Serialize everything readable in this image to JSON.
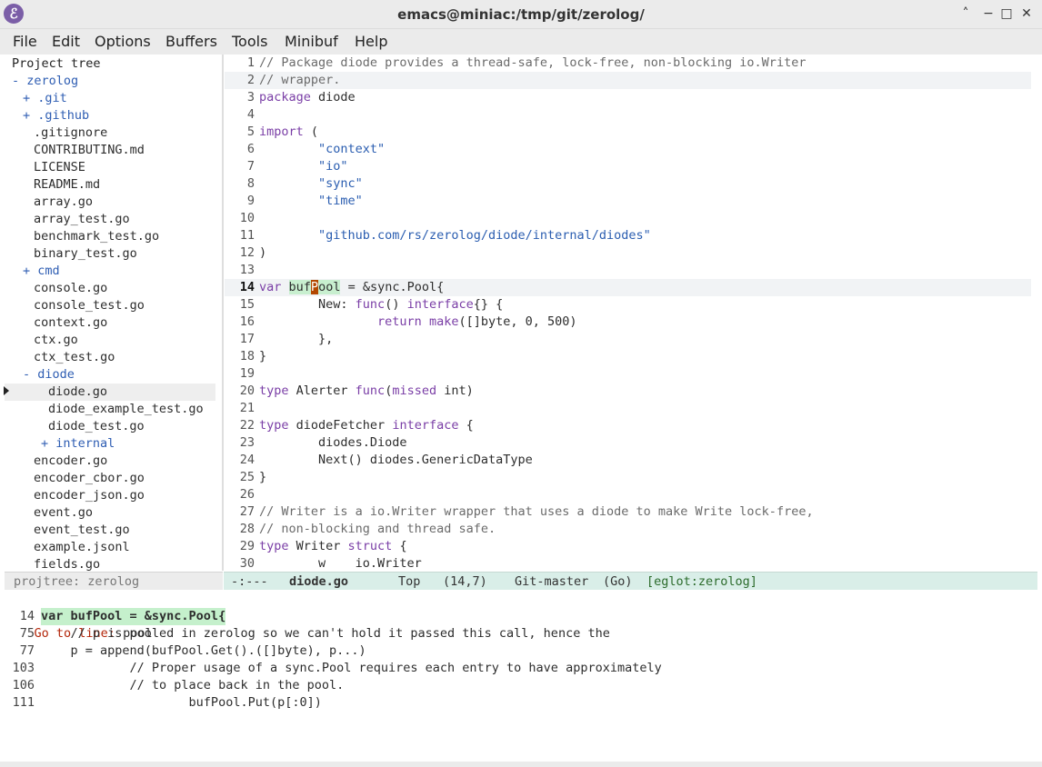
{
  "window": {
    "title": "emacs@miniac:/tmp/git/zerolog/",
    "app_icon": "emacs-icon",
    "app_icon_glyph": "ℰ",
    "controls": [
      "˄",
      "−",
      "□",
      "✕"
    ]
  },
  "menubar": {
    "items": [
      "File",
      "Edit",
      "Options",
      "Buffers",
      "Tools",
      "Minibuf",
      "Help"
    ]
  },
  "tree": {
    "header": "Project tree",
    "rows": [
      {
        "text": "- zerolog",
        "kind": "dir",
        "indent": 0
      },
      {
        "text": "+ .git",
        "kind": "dir",
        "indent": 1
      },
      {
        "text": "+ .github",
        "kind": "dir",
        "indent": 1
      },
      {
        "text": ".gitignore",
        "kind": "file",
        "indent": 2
      },
      {
        "text": "CONTRIBUTING.md",
        "kind": "file",
        "indent": 2
      },
      {
        "text": "LICENSE",
        "kind": "file",
        "indent": 2
      },
      {
        "text": "README.md",
        "kind": "file",
        "indent": 2
      },
      {
        "text": "array.go",
        "kind": "file",
        "indent": 2
      },
      {
        "text": "array_test.go",
        "kind": "file",
        "indent": 2
      },
      {
        "text": "benchmark_test.go",
        "kind": "file",
        "indent": 2
      },
      {
        "text": "binary_test.go",
        "kind": "file",
        "indent": 2
      },
      {
        "text": "+ cmd",
        "kind": "dir",
        "indent": 1
      },
      {
        "text": "console.go",
        "kind": "file",
        "indent": 2
      },
      {
        "text": "console_test.go",
        "kind": "file",
        "indent": 2
      },
      {
        "text": "context.go",
        "kind": "file",
        "indent": 2
      },
      {
        "text": "ctx.go",
        "kind": "file",
        "indent": 2
      },
      {
        "text": "ctx_test.go",
        "kind": "file",
        "indent": 2
      },
      {
        "text": "- diode",
        "kind": "dir",
        "indent": 1
      },
      {
        "text": "diode.go",
        "kind": "file",
        "indent": 4,
        "selected": true
      },
      {
        "text": "diode_example_test.go",
        "kind": "file",
        "indent": 4
      },
      {
        "text": "diode_test.go",
        "kind": "file",
        "indent": 4
      },
      {
        "text": "+ internal",
        "kind": "dir",
        "indent": 3
      },
      {
        "text": "encoder.go",
        "kind": "file",
        "indent": 2
      },
      {
        "text": "encoder_cbor.go",
        "kind": "file",
        "indent": 2
      },
      {
        "text": "encoder_json.go",
        "kind": "file",
        "indent": 2
      },
      {
        "text": "event.go",
        "kind": "file",
        "indent": 2
      },
      {
        "text": "event_test.go",
        "kind": "file",
        "indent": 2
      },
      {
        "text": "example.jsonl",
        "kind": "file",
        "indent": 2
      },
      {
        "text": "fields.go",
        "kind": "file",
        "indent": 2
      }
    ]
  },
  "editor": {
    "current_line": 14,
    "lines": [
      {
        "n": 1,
        "segs": [
          [
            "cm",
            "// Package diode provides a thread-safe, lock-free, non-blocking io.Writer"
          ]
        ]
      },
      {
        "n": 2,
        "segs": [
          [
            "cm",
            "// wrapper."
          ]
        ],
        "hl": true
      },
      {
        "n": 3,
        "segs": [
          [
            "kw",
            "package"
          ],
          [
            "",
            " diode"
          ]
        ]
      },
      {
        "n": 4,
        "segs": []
      },
      {
        "n": 5,
        "segs": [
          [
            "kw",
            "import"
          ],
          [
            "",
            " ("
          ]
        ]
      },
      {
        "n": 6,
        "segs": [
          [
            "",
            "        "
          ],
          [
            "st",
            "\"context\""
          ]
        ]
      },
      {
        "n": 7,
        "segs": [
          [
            "",
            "        "
          ],
          [
            "st",
            "\"io\""
          ]
        ]
      },
      {
        "n": 8,
        "segs": [
          [
            "",
            "        "
          ],
          [
            "st",
            "\"sync\""
          ]
        ]
      },
      {
        "n": 9,
        "segs": [
          [
            "",
            "        "
          ],
          [
            "st",
            "\"time\""
          ]
        ]
      },
      {
        "n": 10,
        "segs": []
      },
      {
        "n": 11,
        "segs": [
          [
            "",
            "        "
          ],
          [
            "st",
            "\"github.com/rs/zerolog/diode/internal/diodes\""
          ]
        ]
      },
      {
        "n": 12,
        "segs": [
          [
            "",
            ")"
          ]
        ]
      },
      {
        "n": 13,
        "segs": []
      },
      {
        "n": 14,
        "segs": [
          [
            "kw",
            "var"
          ],
          [
            "",
            " "
          ],
          [
            "sym-hl",
            "buf"
          ],
          [
            "cursor",
            "P"
          ],
          [
            "sym-hl",
            "ool"
          ],
          [
            "",
            " = &sync.Pool{"
          ]
        ],
        "hl": true
      },
      {
        "n": 15,
        "segs": [
          [
            "",
            "        New: "
          ],
          [
            "kw",
            "func"
          ],
          [
            "",
            "() "
          ],
          [
            "kw",
            "interface"
          ],
          [
            "",
            "{} {"
          ]
        ]
      },
      {
        "n": 16,
        "segs": [
          [
            "",
            "                "
          ],
          [
            "kw",
            "return"
          ],
          [
            "",
            " "
          ],
          [
            "fn",
            "make"
          ],
          [
            "",
            "([]byte, 0, 500)"
          ]
        ]
      },
      {
        "n": 17,
        "segs": [
          [
            "",
            "        },"
          ]
        ]
      },
      {
        "n": 18,
        "segs": [
          [
            "",
            "}"
          ]
        ]
      },
      {
        "n": 19,
        "segs": []
      },
      {
        "n": 20,
        "segs": [
          [
            "kw",
            "type"
          ],
          [
            "",
            " Alerter "
          ],
          [
            "kw",
            "func"
          ],
          [
            "",
            "("
          ],
          [
            "kw",
            "missed"
          ],
          [
            "",
            " int)"
          ]
        ]
      },
      {
        "n": 21,
        "segs": []
      },
      {
        "n": 22,
        "segs": [
          [
            "kw",
            "type"
          ],
          [
            "",
            " diodeFetcher "
          ],
          [
            "kw",
            "interface"
          ],
          [
            "",
            " {"
          ]
        ]
      },
      {
        "n": 23,
        "segs": [
          [
            "",
            "        diodes.Diode"
          ]
        ]
      },
      {
        "n": 24,
        "segs": [
          [
            "",
            "        Next() diodes.GenericDataType"
          ]
        ]
      },
      {
        "n": 25,
        "segs": [
          [
            "",
            "}"
          ]
        ]
      },
      {
        "n": 26,
        "segs": []
      },
      {
        "n": 27,
        "segs": [
          [
            "cm",
            "// Writer is a io.Writer wrapper that uses a diode to make Write lock-free,"
          ]
        ]
      },
      {
        "n": 28,
        "segs": [
          [
            "cm",
            "// non-blocking and thread safe."
          ]
        ]
      },
      {
        "n": 29,
        "segs": [
          [
            "kw",
            "type"
          ],
          [
            "",
            " Writer "
          ],
          [
            "kw",
            "struct"
          ],
          [
            "",
            " {"
          ]
        ]
      },
      {
        "n": 30,
        "segs": [
          [
            "",
            "        w    io.Writer"
          ]
        ]
      }
    ]
  },
  "modeline": {
    "tree": "projtree: zerolog",
    "status": "-:---",
    "buffer": "diode.go",
    "position": "Top",
    "line_col": "(14,7)",
    "vc": "Git-master",
    "mode": "(Go)",
    "eglot": "[eglot:zerolog]"
  },
  "minibuffer": {
    "count": "1/6",
    "prompt": "Go to line: ",
    "input": "pool",
    "candidates": [
      {
        "n": "14",
        "text": "var bufPool = &sync.Pool{",
        "selected": true
      },
      {
        "n": "75",
        "text": "    // p is pooled in zerolog so we can't hold it passed this call, hence the"
      },
      {
        "n": "77",
        "text": "    p = append(bufPool.Get().([]byte), p...)"
      },
      {
        "n": "103",
        "text": "            // Proper usage of a sync.Pool requires each entry to have approximately"
      },
      {
        "n": "106",
        "text": "            // to place back in the pool."
      },
      {
        "n": "111",
        "text": "                    bufPool.Put(p[:0])"
      }
    ]
  }
}
